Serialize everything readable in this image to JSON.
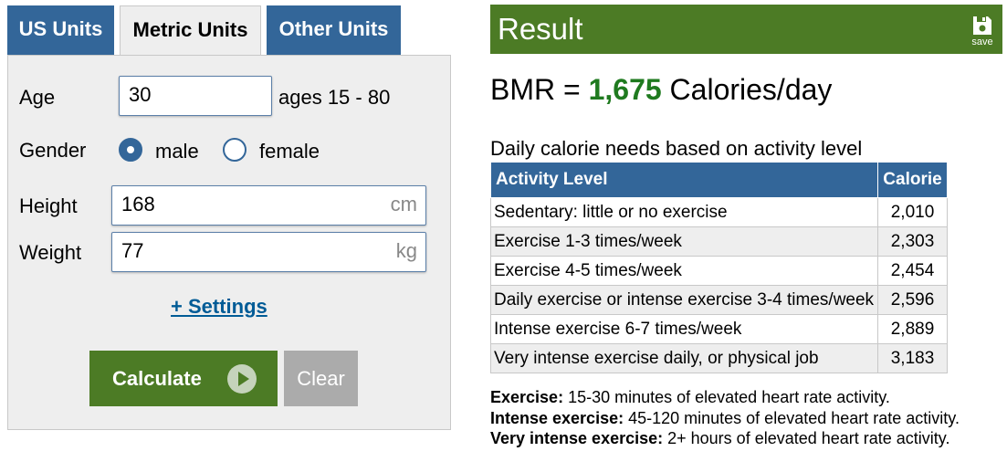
{
  "tabs": [
    {
      "label": "US Units",
      "active": false
    },
    {
      "label": "Metric Units",
      "active": true
    },
    {
      "label": "Other Units",
      "active": false
    }
  ],
  "form": {
    "age_label": "Age",
    "age_value": "30",
    "age_hint": "ages 15 - 80",
    "gender_label": "Gender",
    "gender_male": "male",
    "gender_female": "female",
    "gender_selected": "male",
    "height_label": "Height",
    "height_value": "168",
    "height_unit": "cm",
    "weight_label": "Weight",
    "weight_value": "77",
    "weight_unit": "kg",
    "settings_link": "+ Settings",
    "calculate_label": "Calculate",
    "clear_label": "Clear"
  },
  "result": {
    "title": "Result",
    "save_label": "save",
    "bmr_prefix": "BMR = ",
    "bmr_value": "1,675",
    "bmr_suffix": " Calories/day",
    "daily_heading": "Daily calorie needs based on activity level",
    "table": {
      "headers": [
        "Activity Level",
        "Calorie"
      ],
      "rows": [
        [
          "Sedentary: little or no exercise",
          "2,010"
        ],
        [
          "Exercise 1-3 times/week",
          "2,303"
        ],
        [
          "Exercise 4-5 times/week",
          "2,454"
        ],
        [
          "Daily exercise or intense exercise 3-4 times/week",
          "2,596"
        ],
        [
          "Intense exercise 6-7 times/week",
          "2,889"
        ],
        [
          "Very intense exercise daily, or physical job",
          "3,183"
        ]
      ]
    },
    "notes": [
      {
        "term": "Exercise:",
        "desc": " 15-30 minutes of elevated heart rate activity."
      },
      {
        "term": "Intense exercise:",
        "desc": " 45-120 minutes of elevated heart rate activity."
      },
      {
        "term": "Very intense exercise:",
        "desc": " 2+ hours of elevated heart rate activity."
      }
    ]
  },
  "colors": {
    "tab_blue": "#336699",
    "result_green": "#4c7b25",
    "bmr_green": "#1f7a1f",
    "clear_gray": "#ababab",
    "panel_bg": "#eeeeee",
    "link_blue": "#005b96"
  },
  "icons": {
    "save": "floppy-disk-icon",
    "calculate": "play-circle-icon"
  }
}
